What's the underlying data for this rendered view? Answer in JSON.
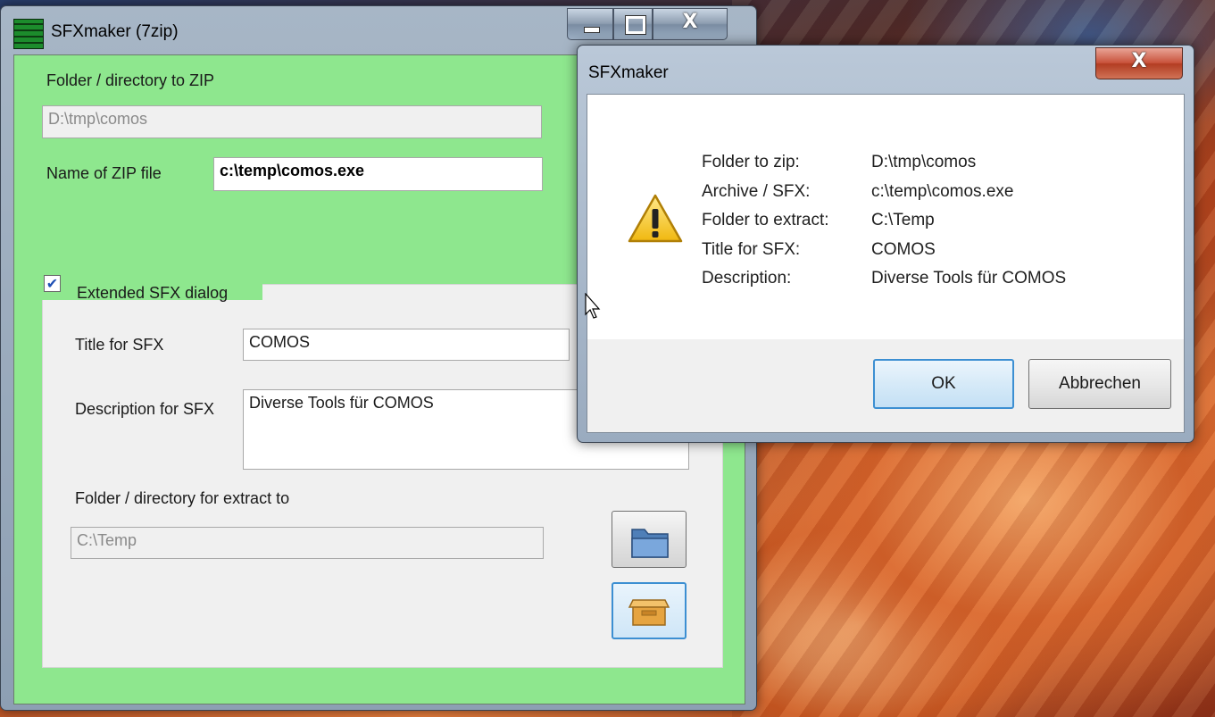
{
  "main_window": {
    "title": "SFXmaker (7zip)",
    "folder_label": "Folder / directory to ZIP",
    "folder_value": "D:\\tmp\\comos",
    "zip_name_label": "Name of ZIP file",
    "zip_name_value": "c:\\temp\\comos.exe",
    "extended_checkbox_label": "Extended SFX dialog",
    "extended_checked": true,
    "title_sfx_label": "Title for SFX",
    "title_sfx_value": "COMOS",
    "description_label": "Description for SFX",
    "description_value": "Diverse Tools für COMOS",
    "extract_label": "Folder / directory for extract to",
    "extract_value": "C:\\Temp"
  },
  "message_box": {
    "title": "SFXmaker",
    "rows": [
      {
        "key": "Folder to zip:",
        "value": "D:\\tmp\\comos"
      },
      {
        "key": "Archive / SFX:",
        "value": "c:\\temp\\comos.exe"
      },
      {
        "key": "Folder to extract:",
        "value": "C:\\Temp"
      },
      {
        "key": "Title for SFX:",
        "value": "COMOS"
      },
      {
        "key": "Description:",
        "value": "Diverse Tools für COMOS"
      }
    ],
    "ok_label": "OK",
    "cancel_label": "Abbrechen"
  }
}
